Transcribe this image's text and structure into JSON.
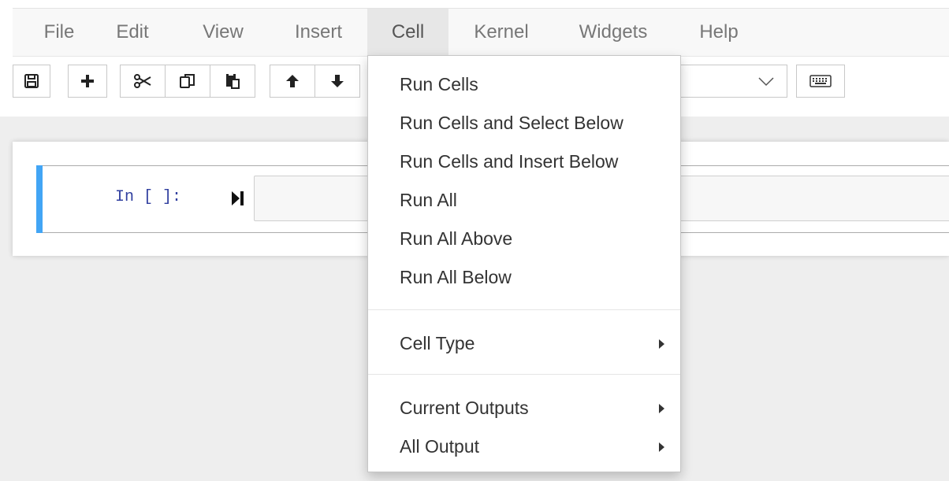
{
  "menubar": {
    "items": [
      {
        "label": "File"
      },
      {
        "label": "Edit"
      },
      {
        "label": "View"
      },
      {
        "label": "Insert"
      },
      {
        "label": "Cell",
        "active": true
      },
      {
        "label": "Kernel"
      },
      {
        "label": "Widgets"
      },
      {
        "label": "Help"
      }
    ]
  },
  "toolbar": {
    "buttons": [
      "save-icon",
      "plus-icon",
      "scissors-icon",
      "copy-icon",
      "paste-icon",
      "arrow-up-icon",
      "arrow-down-icon"
    ],
    "cell_type_select": {
      "selected": ""
    },
    "keyboard_button": "keyboard-icon"
  },
  "notebook": {
    "cell": {
      "prompt": "In [ ]:",
      "code": ""
    }
  },
  "cell_menu": {
    "items": [
      {
        "label": "Run Cells"
      },
      {
        "label": "Run Cells and Select Below"
      },
      {
        "label": "Run Cells and Insert Below"
      },
      {
        "label": "Run All"
      },
      {
        "label": "Run All Above"
      },
      {
        "label": "Run All Below"
      },
      {
        "label": "Cell Type",
        "submenu": true
      },
      {
        "label": "Current Outputs",
        "submenu": true
      },
      {
        "label": "All Output",
        "submenu": true
      }
    ]
  },
  "colors": {
    "cell_selected_bar": "#42a5f5",
    "prompt": "#303f9f",
    "menubar_bg": "#f8f8f8",
    "active_menu_bg": "#e7e7e7"
  }
}
